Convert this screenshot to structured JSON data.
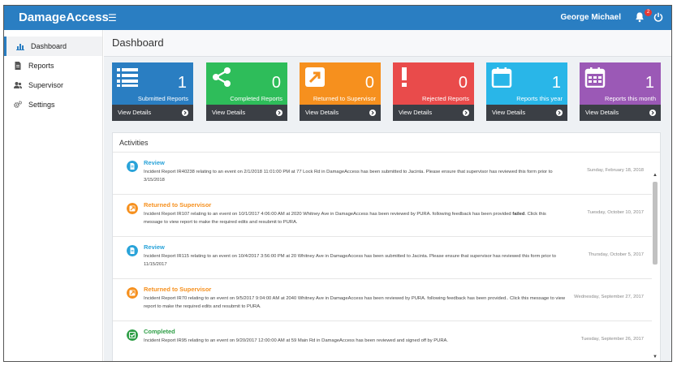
{
  "app": {
    "brand": "DamageAccess"
  },
  "topbar": {
    "user_name": "George Michael",
    "notification_count": "2"
  },
  "sidebar": {
    "items": [
      {
        "label": "Dashboard",
        "icon": "bar-chart-icon"
      },
      {
        "label": "Reports",
        "icon": "file-icon"
      },
      {
        "label": "Supervisor",
        "icon": "users-icon"
      },
      {
        "label": "Settings",
        "icon": "gears-icon"
      }
    ]
  },
  "page": {
    "title": "Dashboard"
  },
  "cards": [
    {
      "label": "Submitted Reports",
      "count": "1",
      "footer": "View Details",
      "color": "#2a7ec2",
      "icon": "list-icon"
    },
    {
      "label": "Completed Reports",
      "count": "0",
      "footer": "View Details",
      "color": "#2ebd5a",
      "icon": "share-icon"
    },
    {
      "label": "Returned to Supervisor",
      "count": "0",
      "footer": "View Details",
      "color": "#f6901e",
      "icon": "external-link-icon"
    },
    {
      "label": "Rejected Reports",
      "count": "0",
      "footer": "View Details",
      "color": "#e94b4b",
      "icon": "exclamation-icon"
    },
    {
      "label": "Reports this year",
      "count": "1",
      "footer": "View Details",
      "color": "#29b6e8",
      "icon": "calendar-blank-icon"
    },
    {
      "label": "Reports this month",
      "count": "1",
      "footer": "View Details",
      "color": "#9b59b6",
      "icon": "calendar-icon"
    }
  ],
  "activities": {
    "title": "Activities",
    "items": [
      {
        "type": "review",
        "heading": "Review",
        "text": "Incident Report IR40238 relating to an event on 2/1/2018 11:01:00 PM at 77 Lock Rd in DamageAccess has been submitted to Jacinta. Please ensure that supervisor has reviewed this form prior to 3/15/2018",
        "date": "Sunday, February 18, 2018",
        "color": "#29a3d9"
      },
      {
        "type": "returned",
        "heading": "Returned to Supervisor",
        "text_before": "Incident Report IR107 relating to an event on 10/1/2017 4:06:00 AM at 2020 Whitney Ave in DamageAccess has been reviewed by PURA. following feedback has been provided ",
        "text_strong": "failed",
        "text_after": ". Click this message to view report to make the required edits and resubmit to PURA.",
        "date": "Tuesday, October 10, 2017",
        "color": "#f6901e"
      },
      {
        "type": "review",
        "heading": "Review",
        "text": "Incident Report IR115 relating to an event on 10/4/2017 3:56:00 PM at 20 Whitney Ave in DamageAccess has been submitted to Jacinta. Please ensure that supervisor has reviewed this form prior to 11/15/2017",
        "date": "Thursday, October 5, 2017",
        "color": "#29a3d9"
      },
      {
        "type": "returned",
        "heading": "Returned to Supervisor",
        "text": "Incident Report IR70 relating to an event on 9/5/2017 9:04:00 AM at 2040 Whitney Ave in DamageAccess has been reviewed by PURA. following feedback has been provided.. Click this message to view report to make the required edits and resubmit to PURA.",
        "date": "Wednesday, September 27, 2017",
        "color": "#f6901e"
      },
      {
        "type": "completed",
        "heading": "Completed",
        "text": "Incident Report IR95 relating to an event on 9/20/2017 12:00:00 AM at 59 Main Rd in DamageAccess has been reviewed and signed off by PURA.",
        "date": "Tuesday, September 26, 2017",
        "color": "#2e9e46"
      }
    ]
  }
}
